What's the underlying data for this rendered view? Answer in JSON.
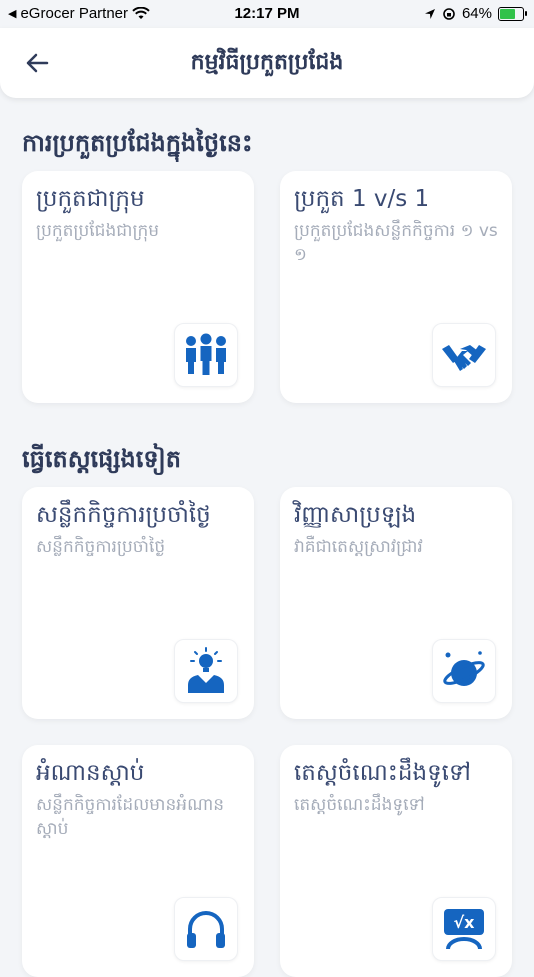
{
  "status": {
    "carrier": "eGrocer Partner",
    "time": "12:17 PM",
    "battery": "64%",
    "battery_level": 0.64
  },
  "header": {
    "title": "កម្មវិធីប្រកួតប្រជែង"
  },
  "section_today": {
    "title": "ការប្រកួតប្រជែងក្នុងថ្ងៃនេះ"
  },
  "section_other": {
    "title": "ធ្វើតេស្តផ្សេងទៀត"
  },
  "cards": [
    {
      "title": "ប្រកួតជាក្រុម",
      "subtitle": "ប្រកួតប្រជែងជាក្រុម",
      "icon": "group-icon"
    },
    {
      "title": "ប្រកួត 1 v/s 1",
      "subtitle": "ប្រកួតប្រជែងសន្លឹកកិច្ចការ ១ vs ១",
      "icon": "handshake-icon"
    },
    {
      "title": "សន្លឹកកិច្ចការប្រចាំថ្ងៃ",
      "subtitle": "សន្លឹកកិច្ចការប្រចាំថ្ងៃ",
      "icon": "idea-person-icon"
    },
    {
      "title": "វិញ្ញាសាប្រឡង",
      "subtitle": "វាគឺជាតេស្តស្រាវជ្រាវ",
      "icon": "planet-icon"
    },
    {
      "title": "អំណានស្តាប់",
      "subtitle": "សន្លឹកកិច្ចការដែលមានអំណានស្តាប់",
      "icon": "headphones-icon"
    },
    {
      "title": "តេស្តចំណេះដឹងទូទៅ",
      "subtitle": "តេស្តចំណេះដឹងទូទៅ",
      "icon": "math-icon"
    }
  ],
  "colors": {
    "accent": "#1565c0",
    "title": "#2f3b5a",
    "subtitle": "#a5acb9",
    "background": "#f3f5f8"
  }
}
